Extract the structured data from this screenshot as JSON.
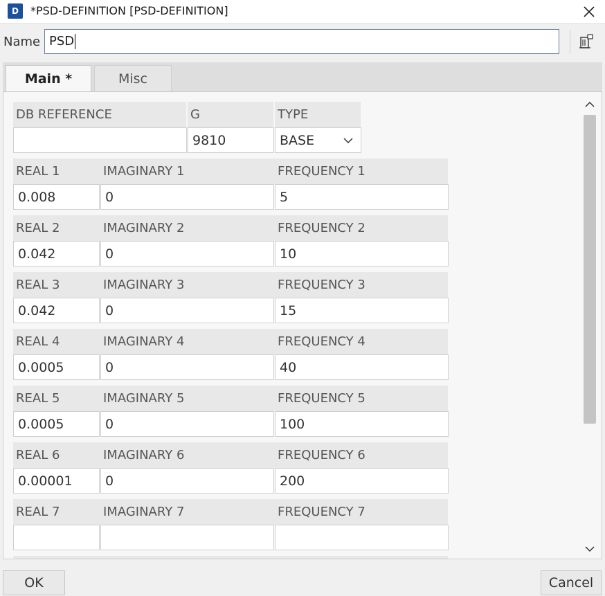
{
  "window": {
    "title": "*PSD-DEFINITION [PSD-DEFINITION]",
    "app_icon": "D"
  },
  "name_row": {
    "label": "Name",
    "value": "PSD"
  },
  "tabs": [
    {
      "label": "Main *",
      "active": true
    },
    {
      "label": "Misc",
      "active": false
    }
  ],
  "header": {
    "db_reference": {
      "label": "DB REFERENCE",
      "value": ""
    },
    "g": {
      "label": "G",
      "value": "9810"
    },
    "type": {
      "label": "TYPE",
      "value": "BASE"
    }
  },
  "rows": [
    {
      "real_label": "REAL 1",
      "imag_label": "IMAGINARY 1",
      "freq_label": "FREQUENCY 1",
      "real": "0.008",
      "imag": "0",
      "freq": "5"
    },
    {
      "real_label": "REAL 2",
      "imag_label": "IMAGINARY 2",
      "freq_label": "FREQUENCY 2",
      "real": "0.042",
      "imag": "0",
      "freq": "10"
    },
    {
      "real_label": "REAL 3",
      "imag_label": "IMAGINARY 3",
      "freq_label": "FREQUENCY 3",
      "real": "0.042",
      "imag": "0",
      "freq": "15"
    },
    {
      "real_label": "REAL 4",
      "imag_label": "IMAGINARY 4",
      "freq_label": "FREQUENCY 4",
      "real": "0.0005",
      "imag": "0",
      "freq": "40"
    },
    {
      "real_label": "REAL 5",
      "imag_label": "IMAGINARY 5",
      "freq_label": "FREQUENCY 5",
      "real": "0.0005",
      "imag": "0",
      "freq": "100"
    },
    {
      "real_label": "REAL 6",
      "imag_label": "IMAGINARY 6",
      "freq_label": "FREQUENCY 6",
      "real": "0.00001",
      "imag": "0",
      "freq": "200"
    },
    {
      "real_label": "REAL 7",
      "imag_label": "IMAGINARY 7",
      "freq_label": "FREQUENCY 7",
      "real": "",
      "imag": "",
      "freq": ""
    }
  ],
  "buttons": {
    "ok": "OK",
    "cancel": "Cancel"
  }
}
